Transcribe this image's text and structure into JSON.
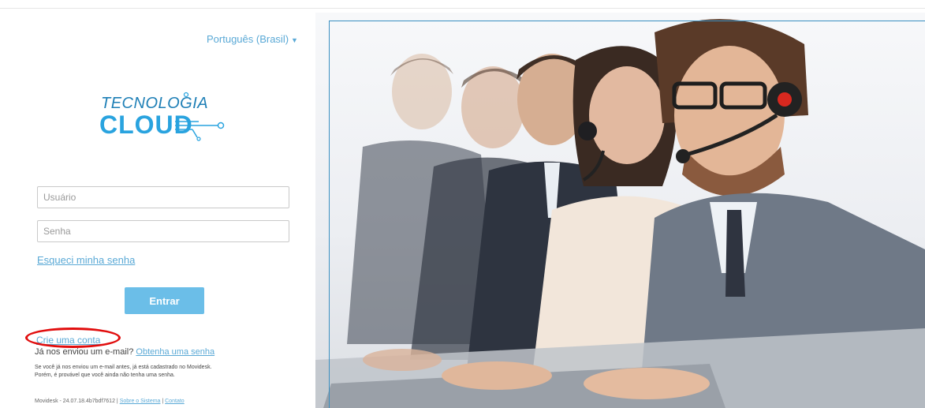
{
  "language": {
    "label": "Português (Brasil)"
  },
  "logo": {
    "line1": "TECNOLOGIA",
    "line2": "CLOUD"
  },
  "login": {
    "user_placeholder": "Usuário",
    "password_placeholder": "Senha",
    "forgot_label": "Esqueci minha senha",
    "submit_label": "Entrar"
  },
  "signup": {
    "create_account": "Crie uma conta",
    "sent_email_prefix": "Já nos enviou um e-mail?",
    "get_password": "Obtenha uma senha",
    "note_line1": "Se você já nos enviou um e-mail antes, já está cadastrado no Movidesk.",
    "note_line2": "Porém, é provável que você ainda não tenha uma senha."
  },
  "footer": {
    "version": "Movidesk - 24.07.18.4b7bdf7612 |",
    "about": "Sobre o Sistema",
    "separator": "|",
    "contact": "Contato"
  },
  "colors": {
    "accent": "#5aa9d6",
    "button": "#6bbee8",
    "highlight_ring": "#e10d0d"
  }
}
